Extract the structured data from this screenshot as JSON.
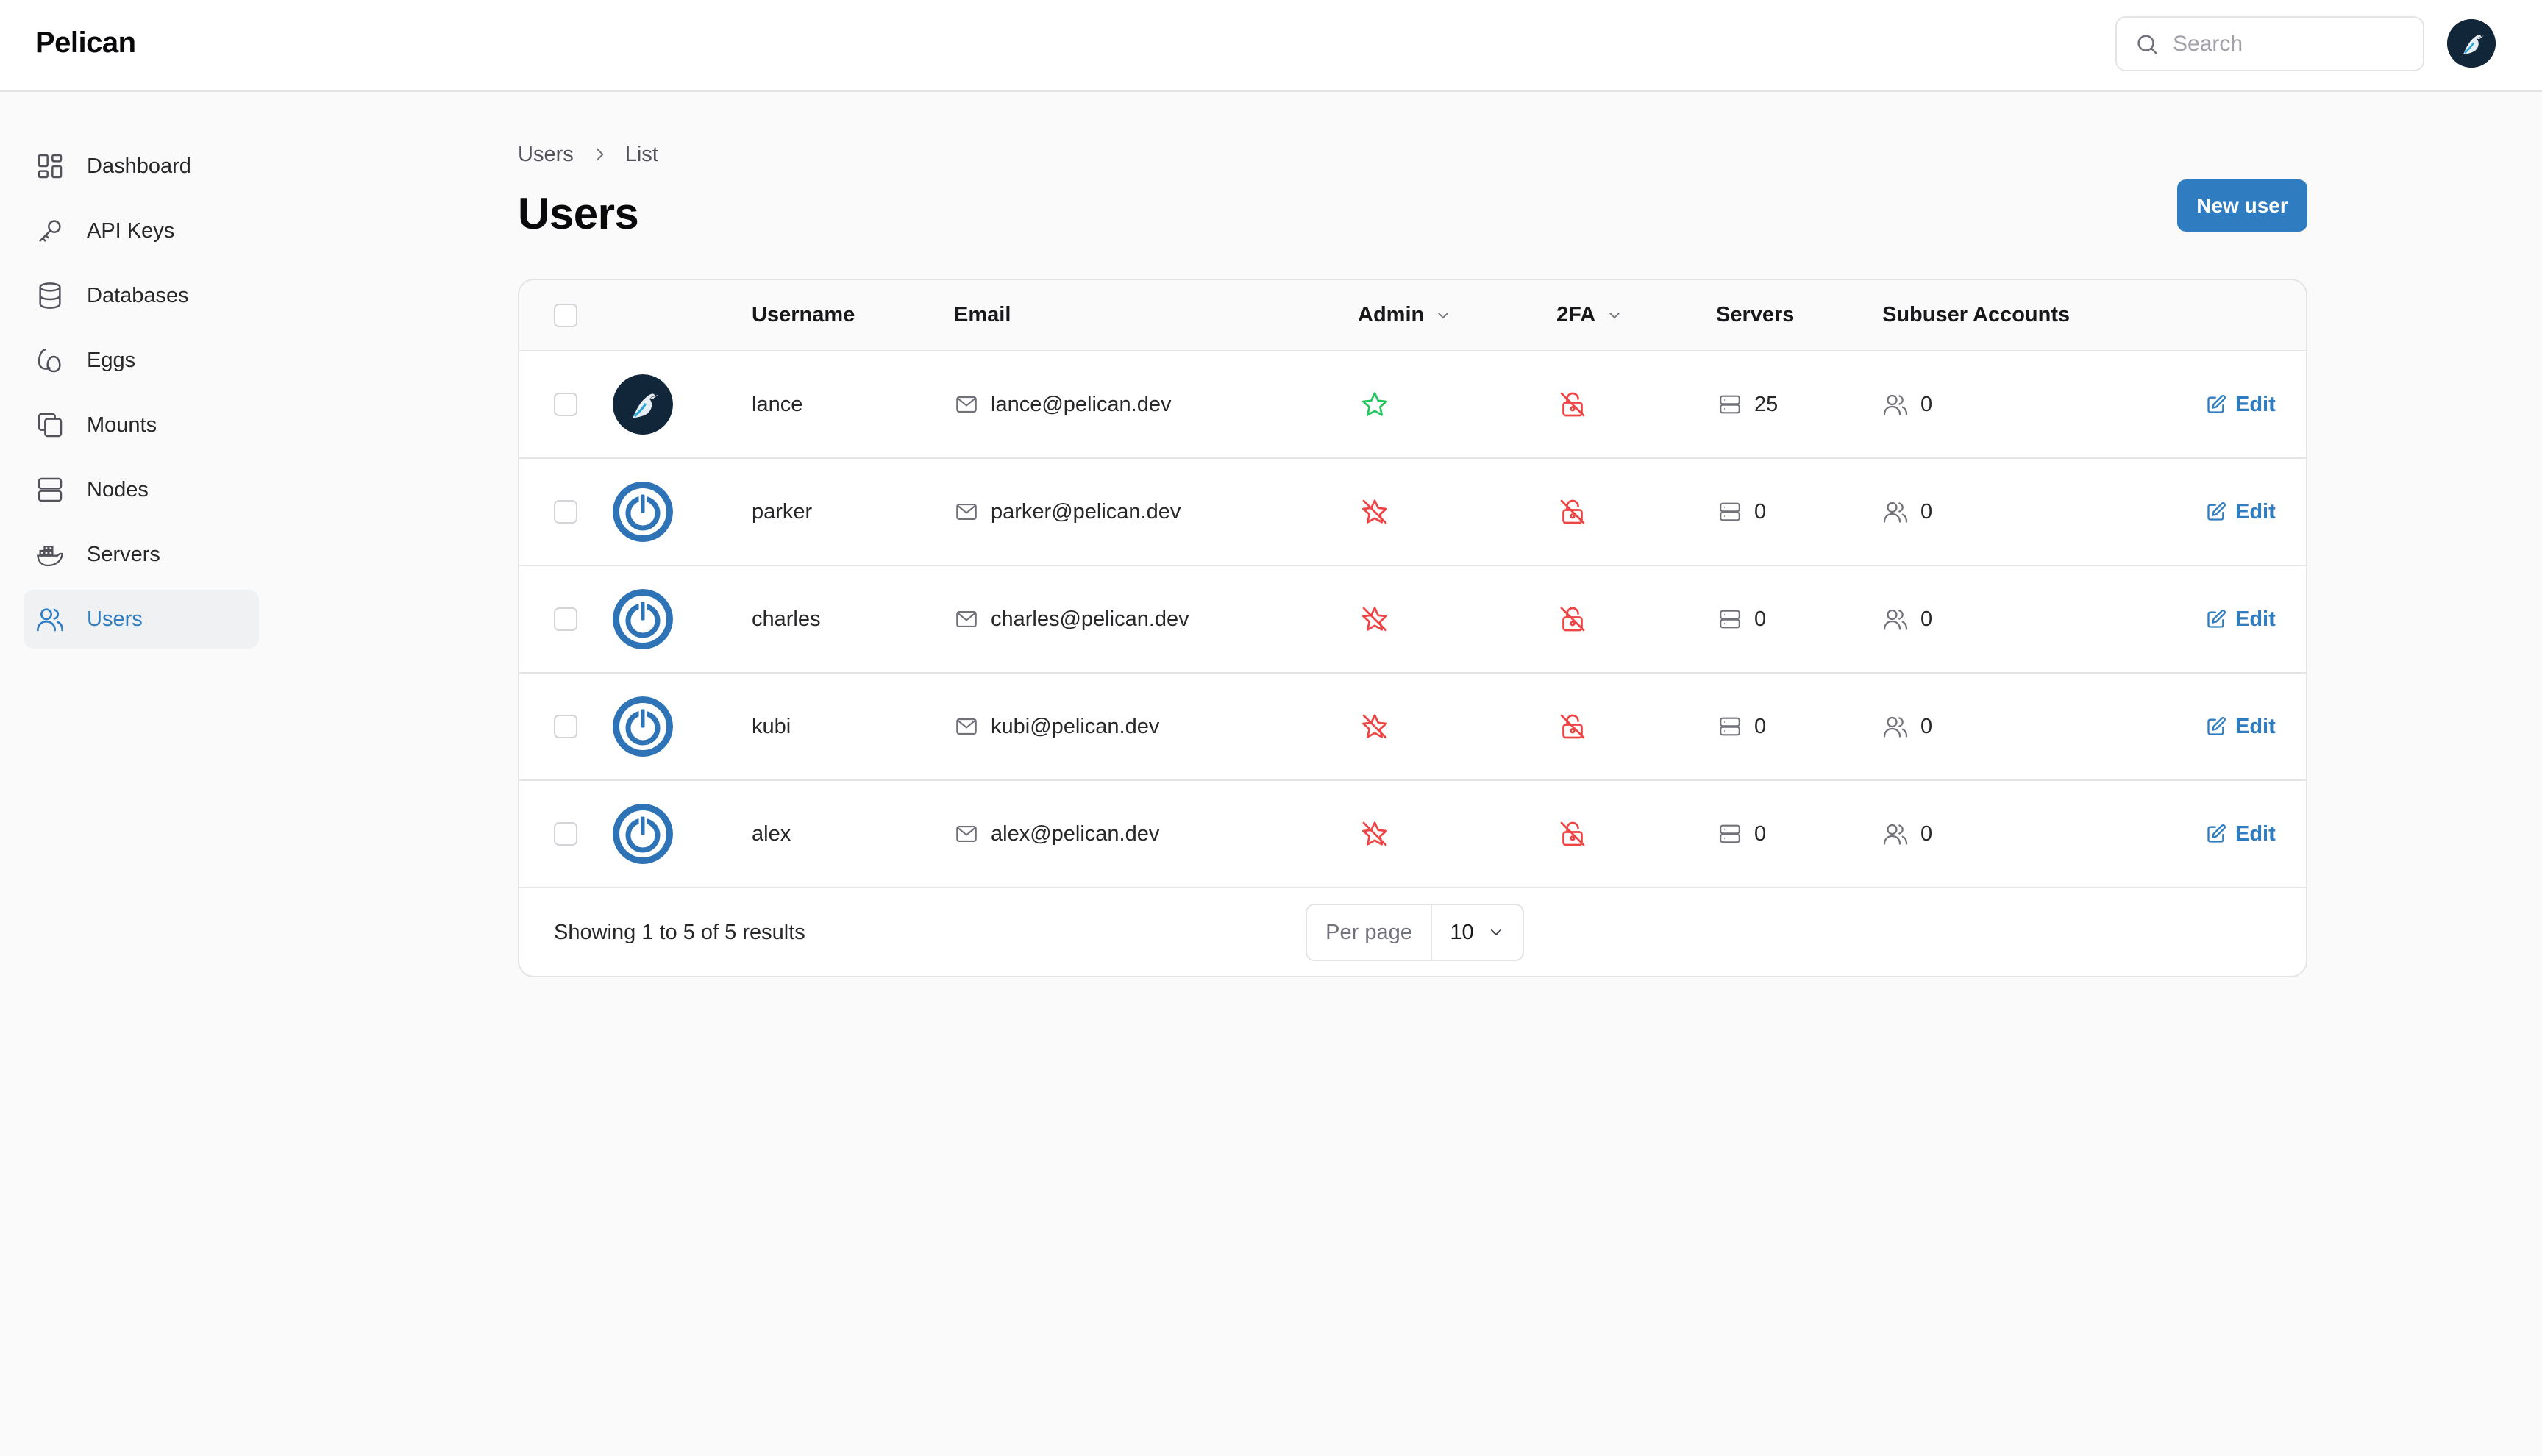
{
  "app": {
    "name": "Pelican"
  },
  "search": {
    "placeholder": "Search"
  },
  "sidebar": {
    "items": [
      {
        "label": "Dashboard",
        "icon": "dashboard-icon"
      },
      {
        "label": "API Keys",
        "icon": "key-icon"
      },
      {
        "label": "Databases",
        "icon": "database-icon"
      },
      {
        "label": "Eggs",
        "icon": "egg-icon"
      },
      {
        "label": "Mounts",
        "icon": "mounts-icon"
      },
      {
        "label": "Nodes",
        "icon": "server-rack-icon"
      },
      {
        "label": "Servers",
        "icon": "docker-icon"
      },
      {
        "label": "Users",
        "icon": "users-icon",
        "active": true
      }
    ]
  },
  "breadcrumb": {
    "items": [
      "Users",
      "List"
    ]
  },
  "page": {
    "title": "Users",
    "new_button": "New user"
  },
  "table": {
    "columns": {
      "username": "Username",
      "email": "Email",
      "admin": "Admin",
      "twofa": "2FA",
      "servers": "Servers",
      "subusers": "Subuser Accounts"
    },
    "rows": [
      {
        "username": "lance",
        "email": "lance@pelican.dev",
        "admin": true,
        "twofa": false,
        "servers": "25",
        "subusers": "0",
        "avatar": "pelican-logo",
        "edit": "Edit"
      },
      {
        "username": "parker",
        "email": "parker@pelican.dev",
        "admin": false,
        "twofa": false,
        "servers": "0",
        "subusers": "0",
        "avatar": "gravatar-default",
        "edit": "Edit"
      },
      {
        "username": "charles",
        "email": "charles@pelican.dev",
        "admin": false,
        "twofa": false,
        "servers": "0",
        "subusers": "0",
        "avatar": "gravatar-default",
        "edit": "Edit"
      },
      {
        "username": "kubi",
        "email": "kubi@pelican.dev",
        "admin": false,
        "twofa": false,
        "servers": "0",
        "subusers": "0",
        "avatar": "gravatar-default",
        "edit": "Edit"
      },
      {
        "username": "alex",
        "email": "alex@pelican.dev",
        "admin": false,
        "twofa": false,
        "servers": "0",
        "subusers": "0",
        "avatar": "gravatar-default",
        "edit": "Edit"
      }
    ],
    "footer": {
      "summary": "Showing 1 to 5 of 5 results",
      "per_page_label": "Per page",
      "per_page_value": "10"
    }
  },
  "colors": {
    "accent": "#2f7dc0",
    "admin_true": "#22c55e",
    "negative": "#ef4444"
  }
}
